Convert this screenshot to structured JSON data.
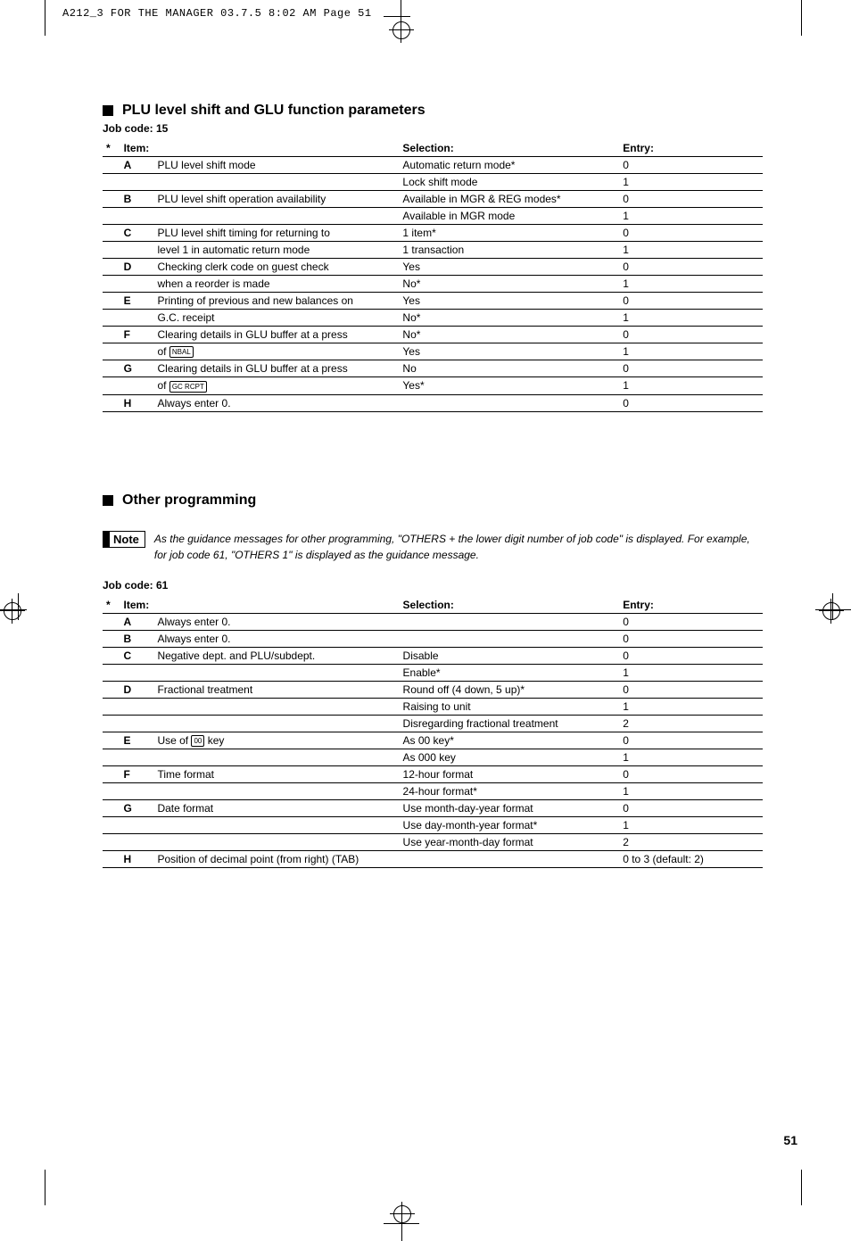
{
  "header_info": "A212_3 FOR THE MANAGER  03.7.5 8:02 AM  Page 51",
  "page_number": "51",
  "section1": {
    "title": "PLU level shift and GLU function parameters",
    "job_code": "Job code:  15",
    "cols": {
      "star": "*",
      "item": "Item:",
      "selection": "Selection:",
      "entry": "Entry:"
    },
    "rows": [
      {
        "letter": "A",
        "item": "PLU level shift mode",
        "sel": "Automatic return mode*",
        "entry": "0",
        "line": true
      },
      {
        "letter": "",
        "item": "",
        "sel": "Lock shift mode",
        "entry": "1",
        "line": true
      },
      {
        "letter": "B",
        "item": "PLU level shift operation availability",
        "sel": "Available in MGR & REG modes*",
        "entry": "0",
        "line": true
      },
      {
        "letter": "",
        "item": "",
        "sel": "Available in MGR mode",
        "entry": "1",
        "line": true
      },
      {
        "letter": "C",
        "item": "PLU level shift timing for returning to",
        "sel": "1 item*",
        "entry": "0",
        "line": true
      },
      {
        "letter": "",
        "item": "level 1 in automatic return mode",
        "sel": "1 transaction",
        "entry": "1",
        "line": true
      },
      {
        "letter": "D",
        "item": "Checking clerk code on guest check",
        "sel": "Yes",
        "entry": "0",
        "line": true
      },
      {
        "letter": "",
        "item": "when a reorder is made",
        "sel": "No*",
        "entry": "1",
        "line": true
      },
      {
        "letter": "E",
        "item": "Printing of previous and new balances on",
        "sel": "Yes",
        "entry": "0",
        "line": true
      },
      {
        "letter": "",
        "item": "G.C. receipt",
        "sel": "No*",
        "entry": "1",
        "line": true
      },
      {
        "letter": "F",
        "item": "Clearing details in GLU buffer at a press",
        "sel": "No*",
        "entry": "0",
        "line": true
      },
      {
        "letter": "",
        "item_key": "of",
        "key_label": "NBAL",
        "sel": "Yes",
        "entry": "1",
        "line": true
      },
      {
        "letter": "G",
        "item": "Clearing details in GLU buffer at a press",
        "sel": "No",
        "entry": "0",
        "line": true
      },
      {
        "letter": "",
        "item_key": "of",
        "key_label": "GC RCPT",
        "sel": "Yes*",
        "entry": "1",
        "line": true
      },
      {
        "letter": "H",
        "item": "Always enter 0.",
        "sel": "",
        "entry": "0",
        "line": true
      }
    ]
  },
  "section2": {
    "title": "Other programming",
    "note_label": "Note",
    "note_text": "As the guidance messages for other programming, \"OTHERS + the lower digit number of job code\" is displayed.  For example, for job code 61, \"OTHERS 1\" is displayed as the guidance message.",
    "job_code": "Job code:  61",
    "cols": {
      "star": "*",
      "item": "Item:",
      "selection": "Selection:",
      "entry": "Entry:"
    },
    "rows": [
      {
        "letter": "A",
        "item": "Always enter 0.",
        "sel": "",
        "entry": "0",
        "line": true
      },
      {
        "letter": "B",
        "item": "Always enter 0.",
        "sel": "",
        "entry": "0",
        "line": true
      },
      {
        "letter": "C",
        "item": "Negative dept. and PLU/subdept.",
        "sel": "Disable",
        "entry": "0",
        "line": true
      },
      {
        "letter": "",
        "item": "",
        "sel": "Enable*",
        "entry": "1",
        "line": true
      },
      {
        "letter": "D",
        "item": "Fractional treatment",
        "sel": "Round off (4 down, 5 up)*",
        "entry": "0",
        "line": true
      },
      {
        "letter": "",
        "item": "",
        "sel": "Raising to unit",
        "entry": "1",
        "line": true
      },
      {
        "letter": "",
        "item": "",
        "sel": "Disregarding fractional treatment",
        "entry": "2",
        "line": true
      },
      {
        "letter": "E",
        "item_key": "Use of",
        "key_label": "00",
        "item_suffix": " key",
        "sel": "As 00 key*",
        "entry": "0",
        "line": true
      },
      {
        "letter": "",
        "item": "",
        "sel": "As 000 key",
        "entry": "1",
        "line": true
      },
      {
        "letter": "F",
        "item": "Time format",
        "sel": "12-hour format",
        "entry": "0",
        "line": true
      },
      {
        "letter": "",
        "item": "",
        "sel": "24-hour format*",
        "entry": "1",
        "line": true
      },
      {
        "letter": "G",
        "item": "Date format",
        "sel": "Use month-day-year format",
        "entry": "0",
        "line": true
      },
      {
        "letter": "",
        "item": "",
        "sel": "Use day-month-year format*",
        "entry": "1",
        "line": true
      },
      {
        "letter": "",
        "item": "",
        "sel": "Use year-month-day format",
        "entry": "2",
        "line": true
      },
      {
        "letter": "H",
        "item": "Position of decimal point (from right) (TAB)",
        "sel": "",
        "entry": "0 to 3 (default: 2)",
        "line": true
      }
    ]
  }
}
